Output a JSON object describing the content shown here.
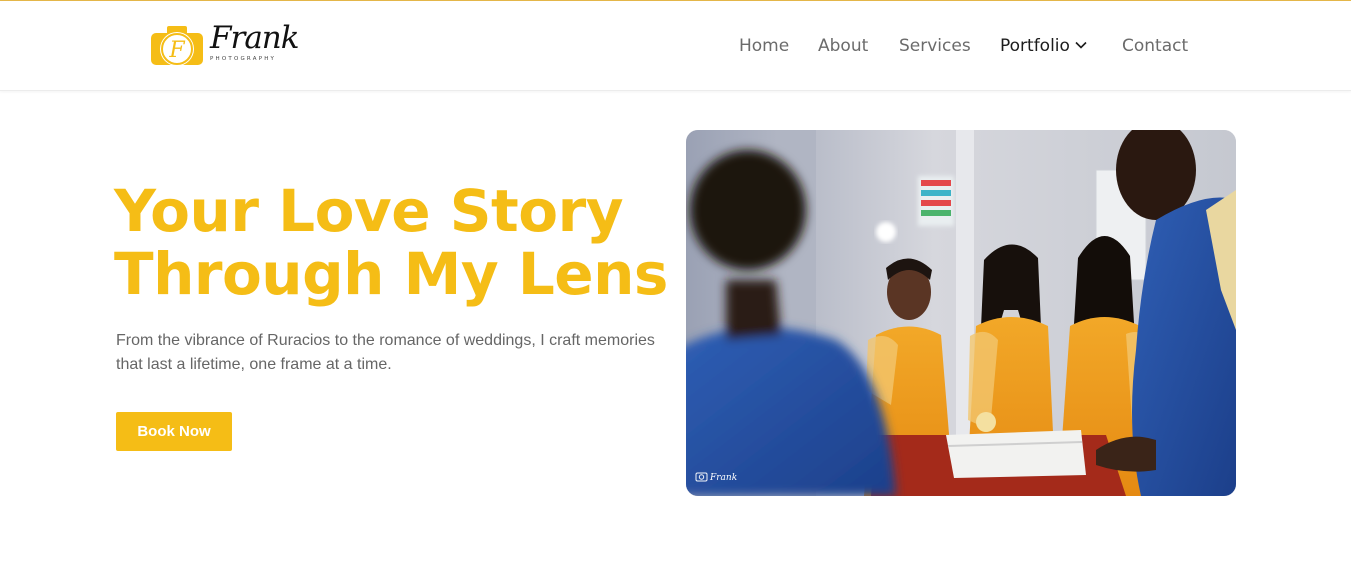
{
  "brand": {
    "name": "Frank",
    "tagline": "PHOTOGRAPHY",
    "accent_color": "#f5bd16",
    "logo_icon": "camera-icon"
  },
  "nav": {
    "items": [
      {
        "label": "Home",
        "active": false
      },
      {
        "label": "About",
        "active": false
      },
      {
        "label": "Services",
        "active": false
      },
      {
        "label": "Portfolio",
        "active": true,
        "has_dropdown": true,
        "dropdown_icon": "chevron-down-icon"
      },
      {
        "label": "Contact",
        "active": false
      }
    ]
  },
  "hero": {
    "title_line1": "Your Love Story",
    "title_line2": "Through My Lens",
    "description": "From the vibrance of Ruracios to the romance of weddings, I craft memories that last a lifetime, one frame at a time.",
    "cta_label": "Book Now",
    "image_alt": "Bridesmaids in yellow dresses standing during a wedding ceremony",
    "watermark": "Frank"
  }
}
